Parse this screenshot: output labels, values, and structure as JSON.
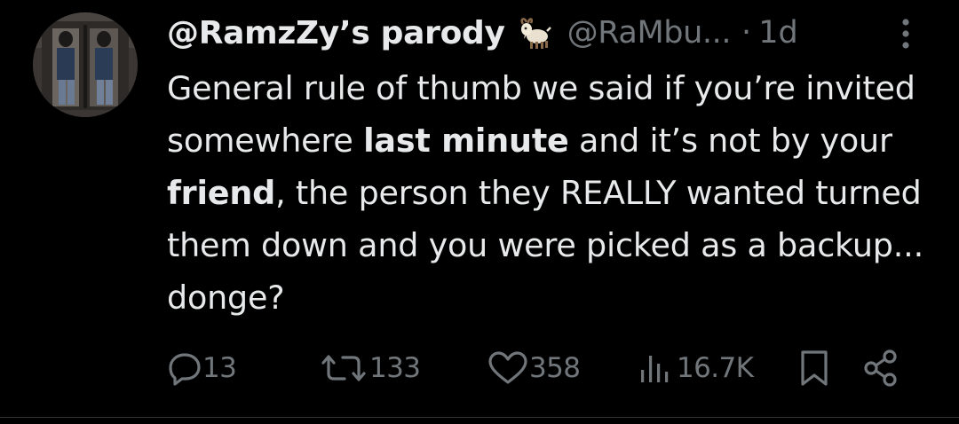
{
  "author": {
    "display_name": "@RamzZy’s parody",
    "handle": "@RaMbu...",
    "separator": "·",
    "time": "1d",
    "badge_icon": "goat-emoji-icon"
  },
  "tweet": {
    "segments": [
      "General rule of thumb we said if you’re invited somewhere ",
      "last minute",
      " and it’s not by your ",
      "friend",
      ", the person they REALLY wanted turned them down and you were picked as a backup... donge?"
    ]
  },
  "actions": {
    "replies": "13",
    "reposts": "133",
    "likes": "358",
    "views": "16.7K"
  },
  "colors": {
    "background": "#000000",
    "primary_text": "#e7e9ea",
    "secondary_text": "#71767b",
    "divider": "#2f3336"
  }
}
